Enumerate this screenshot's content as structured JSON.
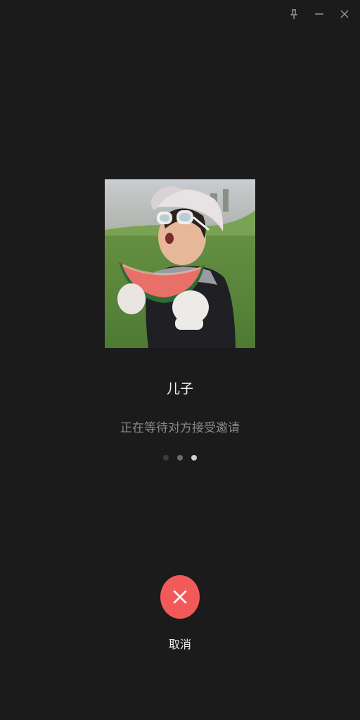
{
  "window_controls": {
    "pin_icon": "pin-icon",
    "minimize_icon": "minimize-icon",
    "close_icon": "close-icon"
  },
  "contact": {
    "name": "儿子"
  },
  "status": {
    "text": "正在等待对方接受邀请"
  },
  "cancel": {
    "label": "取消",
    "color": "#f25a5a"
  },
  "colors": {
    "background": "#1b1b1c",
    "name_text": "#f2f2f2",
    "status_text": "#8a8a8a"
  }
}
